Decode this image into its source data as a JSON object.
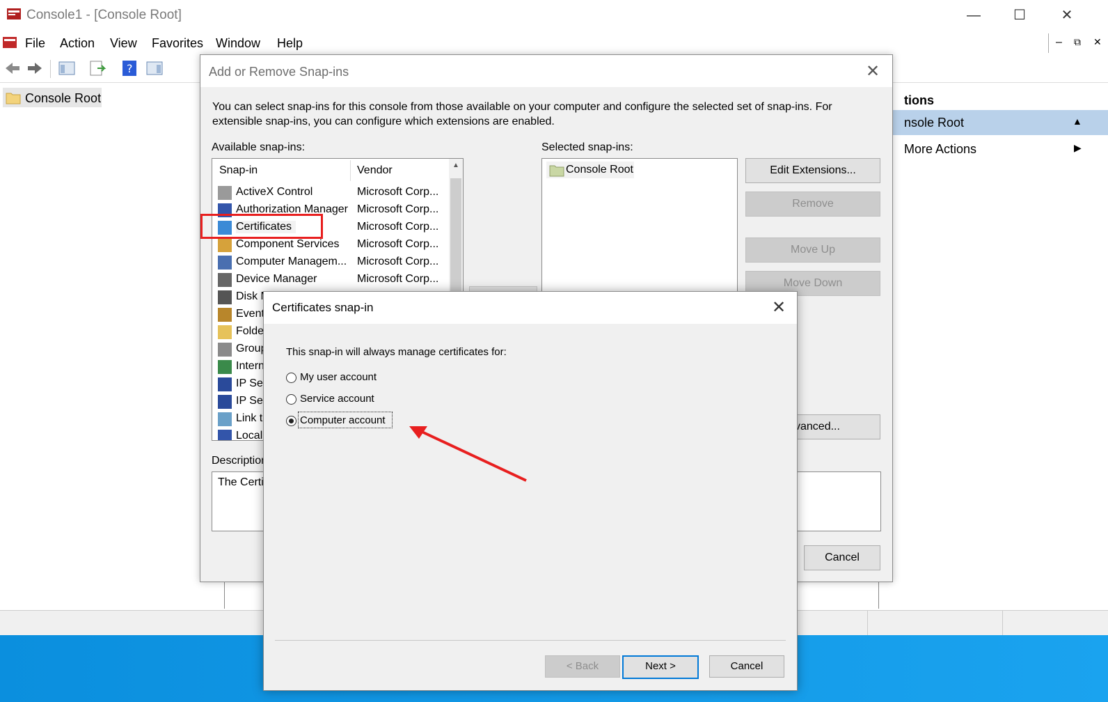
{
  "window": {
    "title": "Console1 - [Console Root]",
    "controls": {
      "minimize": "—",
      "maximize": "☐",
      "close": "✕"
    },
    "mdi_controls": {
      "minimize": "–",
      "restore": "⧉",
      "close": "✕"
    }
  },
  "menu": {
    "file": "File",
    "action": "Action",
    "view": "View",
    "favorites": "Favorites",
    "window": "Window",
    "help": "Help"
  },
  "tree": {
    "root_label": "Console Root"
  },
  "actions_pane": {
    "title": "tions",
    "row_label": "nsole Root",
    "row_arrow": "▲",
    "more_actions": "More Actions",
    "more_arrow": "▶"
  },
  "add_remove": {
    "title": "Add or Remove Snap-ins",
    "close": "✕",
    "intro": "You can select snap-ins for this console from those available on your computer and configure the selected set of snap-ins. For extensible snap-ins, you can configure which extensions are enabled.",
    "available_label": "Available snap-ins:",
    "selected_label": "Selected snap-ins:",
    "columns": {
      "snapin": "Snap-in",
      "vendor": "Vendor"
    },
    "scroll_up": "▲",
    "rows": [
      {
        "name": "ActiveX Control",
        "vendor": "Microsoft Corp..."
      },
      {
        "name": "Authorization Manager",
        "vendor": "Microsoft Corp..."
      },
      {
        "name": "Certificates",
        "vendor": "Microsoft Corp..."
      },
      {
        "name": "Component Services",
        "vendor": "Microsoft Corp..."
      },
      {
        "name": "Computer Managem...",
        "vendor": "Microsoft Corp..."
      },
      {
        "name": "Device Manager",
        "vendor": "Microsoft Corp..."
      },
      {
        "name": "Disk M",
        "vendor": ""
      },
      {
        "name": "Event",
        "vendor": ""
      },
      {
        "name": "Folder",
        "vendor": ""
      },
      {
        "name": "Group",
        "vendor": ""
      },
      {
        "name": "Intern",
        "vendor": ""
      },
      {
        "name": "IP Sec",
        "vendor": ""
      },
      {
        "name": "IP Sec",
        "vendor": ""
      },
      {
        "name": "Link to",
        "vendor": ""
      },
      {
        "name": "Local",
        "vendor": ""
      }
    ],
    "selected_item": "Console Root",
    "buttons": {
      "edit_extensions": "Edit Extensions...",
      "remove": "Remove",
      "move_up": "Move Up",
      "move_down": "Move Down",
      "advanced": "vanced...",
      "cancel": "Cancel"
    },
    "description_label": "Description",
    "description_text": "The Certif"
  },
  "cert_dialog": {
    "title": "Certificates snap-in",
    "close": "✕",
    "prompt": "This snap-in will always manage certificates for:",
    "options": [
      {
        "label": "My user account",
        "selected": false
      },
      {
        "label": "Service account",
        "selected": false
      },
      {
        "label": "Computer account",
        "selected": true
      }
    ],
    "buttons": {
      "back": "< Back",
      "next": "Next >",
      "cancel": "Cancel"
    }
  },
  "colors": {
    "highlight": "#e81f1f",
    "selection_blue": "#b9d1ea",
    "taskbar": "#1aa3ef"
  }
}
